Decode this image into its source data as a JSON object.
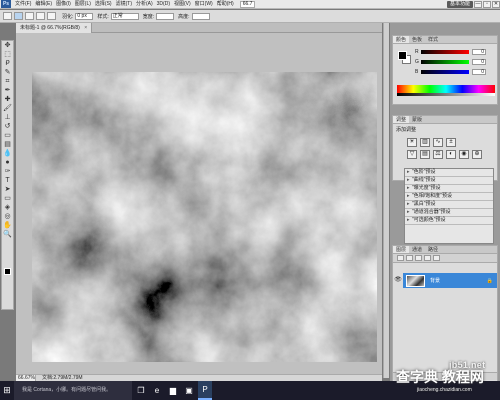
{
  "menubar": {
    "logo": "Ps",
    "items": [
      "文件(F)",
      "编辑(E)",
      "图像(I)",
      "图层(L)",
      "选择(S)",
      "滤镜(T)",
      "分析(A)",
      "3D(D)",
      "视图(V)",
      "窗口(W)",
      "帮助(H)"
    ],
    "zoom": "66.7",
    "workspace": "基本功能",
    "min": "—",
    "restore": "▫",
    "close": "✕"
  },
  "options": {
    "feather_label": "羽化:",
    "feather_value": "0 px",
    "style_label": "样式:",
    "style_value": "正常",
    "width_label": "宽度:",
    "height_label": "高度:"
  },
  "document": {
    "tab_title": "未标题-1 @ 66.7%(RGB/8)",
    "close": "×",
    "status_zoom": "66.67%",
    "status_info": "文档:2.79M/2.79M"
  },
  "color_panel": {
    "tabs": [
      "颜色",
      "色板",
      "样式"
    ],
    "channels": [
      {
        "name": "R",
        "value": "0"
      },
      {
        "name": "G",
        "value": "0"
      },
      {
        "name": "B",
        "value": "0"
      }
    ]
  },
  "adjust_panel": {
    "tabs": [
      "调整",
      "蒙版"
    ],
    "title": "添加调整"
  },
  "presets": [
    "\"色阶\"预设",
    "\"曲线\"预设",
    "\"曝光度\"预设",
    "\"色相/饱和度\"预设",
    "\"黑白\"预设",
    "\"通道混合器\"预设",
    "\"可选颜色\"预设"
  ],
  "layers_panel": {
    "tabs": [
      "图层",
      "通道",
      "路径"
    ],
    "layer_name": "背景",
    "lock": "🔒"
  },
  "taskbar": {
    "search_text": "我是 Cortana，小娜。有问题尽管问我。"
  },
  "watermarks": {
    "site": "jb51.net",
    "brand": "查字典 教程网",
    "url": "jiaocheng.chazidian.com"
  },
  "colors": {
    "layer_selected": "#3a87d8",
    "taskbar": "#1b1b2a"
  }
}
